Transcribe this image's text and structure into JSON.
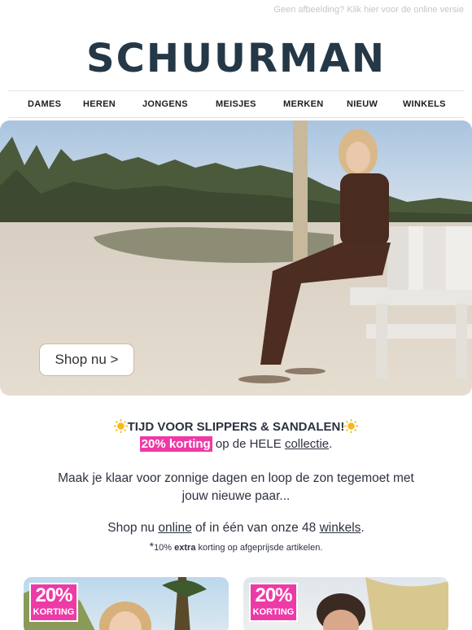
{
  "top_link": "Geen afbeelding? Klik hier voor de online versie",
  "brand": {
    "logo_text": "SCHUURMAN",
    "color": "#243847"
  },
  "nav": [
    "DAMES",
    "HEREN",
    "JONGENS",
    "MEISJES",
    "MERKEN",
    "NIEUW",
    "WINKELS"
  ],
  "hero": {
    "button_label": "Shop nu >"
  },
  "promo": {
    "headline": "TIJD VOOR SLIPPERS & SANDALEN!",
    "discount_badge": "20% korting",
    "offer_mid": "op de HELE",
    "offer_link": "collectie",
    "offer_end": ".",
    "body": "Maak je klaar voor zonnige dagen en loop de zon tegemoet met jouw nieuwe paar...",
    "shop_prefix": "Shop nu",
    "shop_link_online": "online",
    "shop_mid": "of in één van onze 48",
    "shop_link_stores": "winkels",
    "shop_end": ".",
    "footnote_star": "*",
    "footnote_pre": "10%",
    "footnote_bold": "extra",
    "footnote_post": "korting op afgeprijsde artikelen.",
    "accent_color": "#ee3aa6"
  },
  "cards": [
    {
      "pct": "20%",
      "label": "KORTING"
    },
    {
      "pct": "20%",
      "label": "KORTING"
    }
  ]
}
